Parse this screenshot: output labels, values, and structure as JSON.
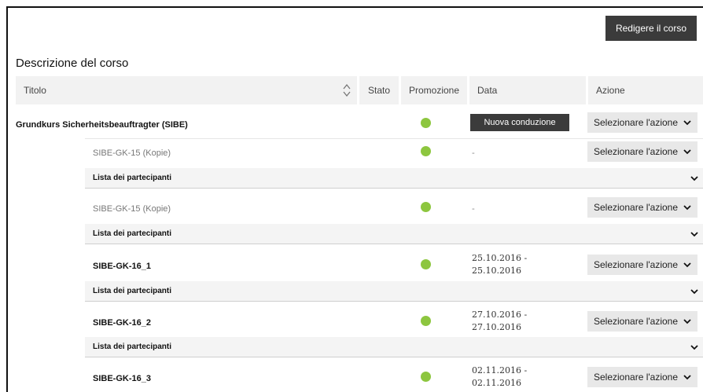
{
  "toolbar": {
    "edit_course_label": "Redigere il corso"
  },
  "section": {
    "title": "Descrizione del corso"
  },
  "table": {
    "headers": {
      "title": "Titolo",
      "stato": "Stato",
      "promozione": "Promozione",
      "data": "Data",
      "azione": "Azione"
    }
  },
  "course": {
    "title": "Grundkurs Sicherheitsbeauftragter (SIBE)",
    "new_run_label": "Nuova conduzione",
    "action_label": "Selezionare l'azione"
  },
  "runs": [
    {
      "title": "SIBE-GK-15 (Kopie)",
      "date_line1": "-",
      "date_line2": "",
      "action_label": "Selezionare l'azione",
      "participants_label": "Lista dei partecipanti"
    },
    {
      "title": "SIBE-GK-15 (Kopie)",
      "date_line1": "-",
      "date_line2": "",
      "action_label": "Selezionare l'azione",
      "participants_label": "Lista dei partecipanti"
    },
    {
      "title": "SIBE-GK-16_1",
      "date_line1": "25.10.2016 -",
      "date_line2": "25.10.2016",
      "action_label": "Selezionare l'azione",
      "participants_label": "Lista dei partecipanti"
    },
    {
      "title": "SIBE-GK-16_2",
      "date_line1": "27.10.2016 -",
      "date_line2": "27.10.2016",
      "action_label": "Selezionare l'azione",
      "participants_label": "Lista dei partecipanti"
    },
    {
      "title": "SIBE-GK-16_3",
      "date_line1": "02.11.2016 -",
      "date_line2": "02.11.2016",
      "action_label": "Selezionare l'azione"
    }
  ],
  "colors": {
    "promo_dot": "#8dc63f",
    "dark_button": "#3b3b3b",
    "select_bg": "#e8e8e8"
  },
  "icons": {
    "sort": "sort-updown-icon",
    "chevron": "chevron-down-icon"
  }
}
